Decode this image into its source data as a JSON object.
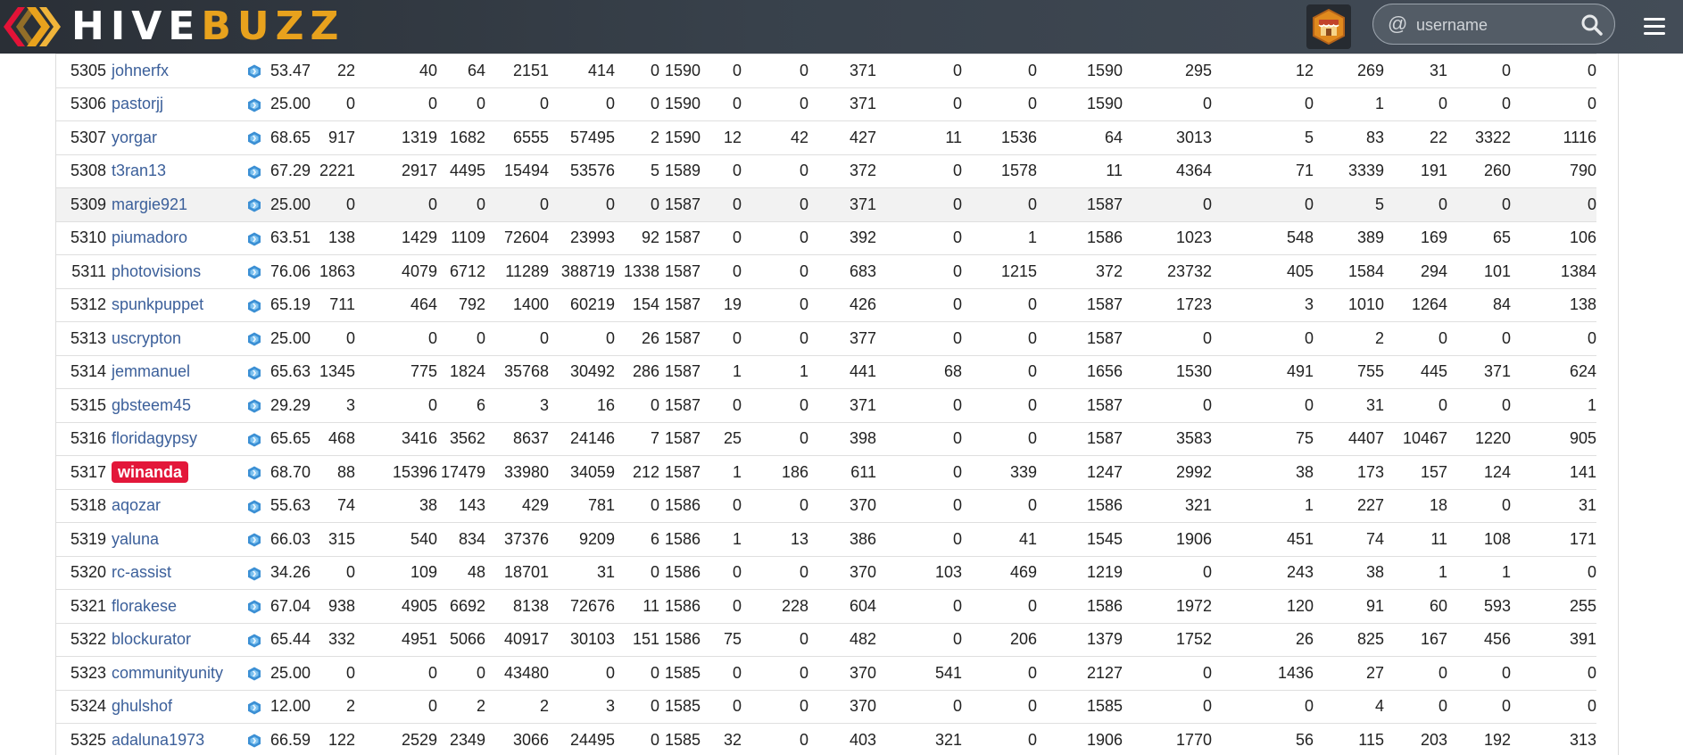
{
  "header": {
    "logo_part1": "HIVE",
    "logo_part2": "BUZZ",
    "search_placeholder": "username",
    "accent_color": "#e8a21d",
    "icons": [
      "hive-logo-icon",
      "shop-icon",
      "at-icon",
      "search-icon",
      "hamburger-menu-icon"
    ]
  },
  "table": {
    "highlight_color": "#e3173a",
    "hover_row_rank": "5309",
    "badge_user": "winanda",
    "rows": [
      [
        "5305",
        "johnerfx",
        "53.47",
        "22",
        "40",
        "64",
        "2151",
        "414",
        "0",
        "1590",
        "0",
        "0",
        "371",
        "0",
        "0",
        "1590",
        "295",
        "12",
        "269",
        "31",
        "0",
        "0"
      ],
      [
        "5306",
        "pastorjj",
        "25.00",
        "0",
        "0",
        "0",
        "0",
        "0",
        "0",
        "1590",
        "0",
        "0",
        "371",
        "0",
        "0",
        "1590",
        "0",
        "0",
        "1",
        "0",
        "0",
        "0"
      ],
      [
        "5307",
        "yorgar",
        "68.65",
        "917",
        "1319",
        "1682",
        "6555",
        "57495",
        "2",
        "1590",
        "12",
        "42",
        "427",
        "11",
        "1536",
        "64",
        "3013",
        "5",
        "83",
        "22",
        "3322",
        "1116"
      ],
      [
        "5308",
        "t3ran13",
        "67.29",
        "2221",
        "2917",
        "4495",
        "15494",
        "53576",
        "5",
        "1589",
        "0",
        "0",
        "372",
        "0",
        "1578",
        "11",
        "4364",
        "71",
        "3339",
        "191",
        "260",
        "790"
      ],
      [
        "5309",
        "margie921",
        "25.00",
        "0",
        "0",
        "0",
        "0",
        "0",
        "0",
        "1587",
        "0",
        "0",
        "371",
        "0",
        "0",
        "1587",
        "0",
        "0",
        "5",
        "0",
        "0",
        "0"
      ],
      [
        "5310",
        "piumadoro",
        "63.51",
        "138",
        "1429",
        "1109",
        "72604",
        "23993",
        "92",
        "1587",
        "0",
        "0",
        "392",
        "0",
        "1",
        "1586",
        "1023",
        "548",
        "389",
        "169",
        "65",
        "106"
      ],
      [
        "5311",
        "photovisions",
        "76.06",
        "1863",
        "4079",
        "6712",
        "11289",
        "388719",
        "1338",
        "1587",
        "0",
        "0",
        "683",
        "0",
        "1215",
        "372",
        "23732",
        "405",
        "1584",
        "294",
        "101",
        "1384"
      ],
      [
        "5312",
        "spunkpuppet",
        "65.19",
        "711",
        "464",
        "792",
        "1400",
        "60219",
        "154",
        "1587",
        "19",
        "0",
        "426",
        "0",
        "0",
        "1587",
        "1723",
        "3",
        "1010",
        "1264",
        "84",
        "138"
      ],
      [
        "5313",
        "uscrypton",
        "25.00",
        "0",
        "0",
        "0",
        "0",
        "0",
        "26",
        "1587",
        "0",
        "0",
        "377",
        "0",
        "0",
        "1587",
        "0",
        "0",
        "2",
        "0",
        "0",
        "0"
      ],
      [
        "5314",
        "jemmanuel",
        "65.63",
        "1345",
        "775",
        "1824",
        "35768",
        "30492",
        "286",
        "1587",
        "1",
        "1",
        "441",
        "68",
        "0",
        "1656",
        "1530",
        "491",
        "755",
        "445",
        "371",
        "624"
      ],
      [
        "5315",
        "gbsteem45",
        "29.29",
        "3",
        "0",
        "6",
        "3",
        "16",
        "0",
        "1587",
        "0",
        "0",
        "371",
        "0",
        "0",
        "1587",
        "0",
        "0",
        "31",
        "0",
        "0",
        "1"
      ],
      [
        "5316",
        "floridagypsy",
        "65.65",
        "468",
        "3416",
        "3562",
        "8637",
        "24146",
        "7",
        "1587",
        "25",
        "0",
        "398",
        "0",
        "0",
        "1587",
        "3583",
        "75",
        "4407",
        "10467",
        "1220",
        "905"
      ],
      [
        "5317",
        "winanda",
        "68.70",
        "88",
        "15396",
        "17479",
        "33980",
        "34059",
        "212",
        "1587",
        "1",
        "186",
        "611",
        "0",
        "339",
        "1247",
        "2992",
        "38",
        "173",
        "157",
        "124",
        "141"
      ],
      [
        "5318",
        "aqozar",
        "55.63",
        "74",
        "38",
        "143",
        "429",
        "781",
        "0",
        "1586",
        "0",
        "0",
        "370",
        "0",
        "0",
        "1586",
        "321",
        "1",
        "227",
        "18",
        "0",
        "31"
      ],
      [
        "5319",
        "yaluna",
        "66.03",
        "315",
        "540",
        "834",
        "37376",
        "9209",
        "6",
        "1586",
        "1",
        "13",
        "386",
        "0",
        "41",
        "1545",
        "1906",
        "451",
        "74",
        "11",
        "108",
        "171"
      ],
      [
        "5320",
        "rc-assist",
        "34.26",
        "0",
        "109",
        "48",
        "18701",
        "31",
        "0",
        "1586",
        "0",
        "0",
        "370",
        "103",
        "469",
        "1219",
        "0",
        "243",
        "38",
        "1",
        "1",
        "0"
      ],
      [
        "5321",
        "florakese",
        "67.04",
        "938",
        "4905",
        "6692",
        "8138",
        "72676",
        "11",
        "1586",
        "0",
        "228",
        "604",
        "0",
        "0",
        "1586",
        "1972",
        "120",
        "91",
        "60",
        "593",
        "255"
      ],
      [
        "5322",
        "blockurator",
        "65.44",
        "332",
        "4951",
        "5066",
        "40917",
        "30103",
        "151",
        "1586",
        "75",
        "0",
        "482",
        "0",
        "206",
        "1379",
        "1752",
        "26",
        "825",
        "167",
        "456",
        "391"
      ],
      [
        "5323",
        "communityunity",
        "25.00",
        "0",
        "0",
        "0",
        "43480",
        "0",
        "0",
        "1585",
        "0",
        "0",
        "370",
        "541",
        "0",
        "2127",
        "0",
        "1436",
        "27",
        "0",
        "0",
        "0"
      ],
      [
        "5324",
        "ghulshof",
        "12.00",
        "2",
        "0",
        "2",
        "2",
        "3",
        "0",
        "1585",
        "0",
        "0",
        "370",
        "0",
        "0",
        "1585",
        "0",
        "0",
        "4",
        "0",
        "0",
        "0"
      ],
      [
        "5325",
        "adaluna1973",
        "66.59",
        "122",
        "2529",
        "2349",
        "3066",
        "24495",
        "0",
        "1585",
        "32",
        "0",
        "403",
        "321",
        "0",
        "1906",
        "1770",
        "56",
        "115",
        "203",
        "192",
        "313"
      ]
    ]
  }
}
